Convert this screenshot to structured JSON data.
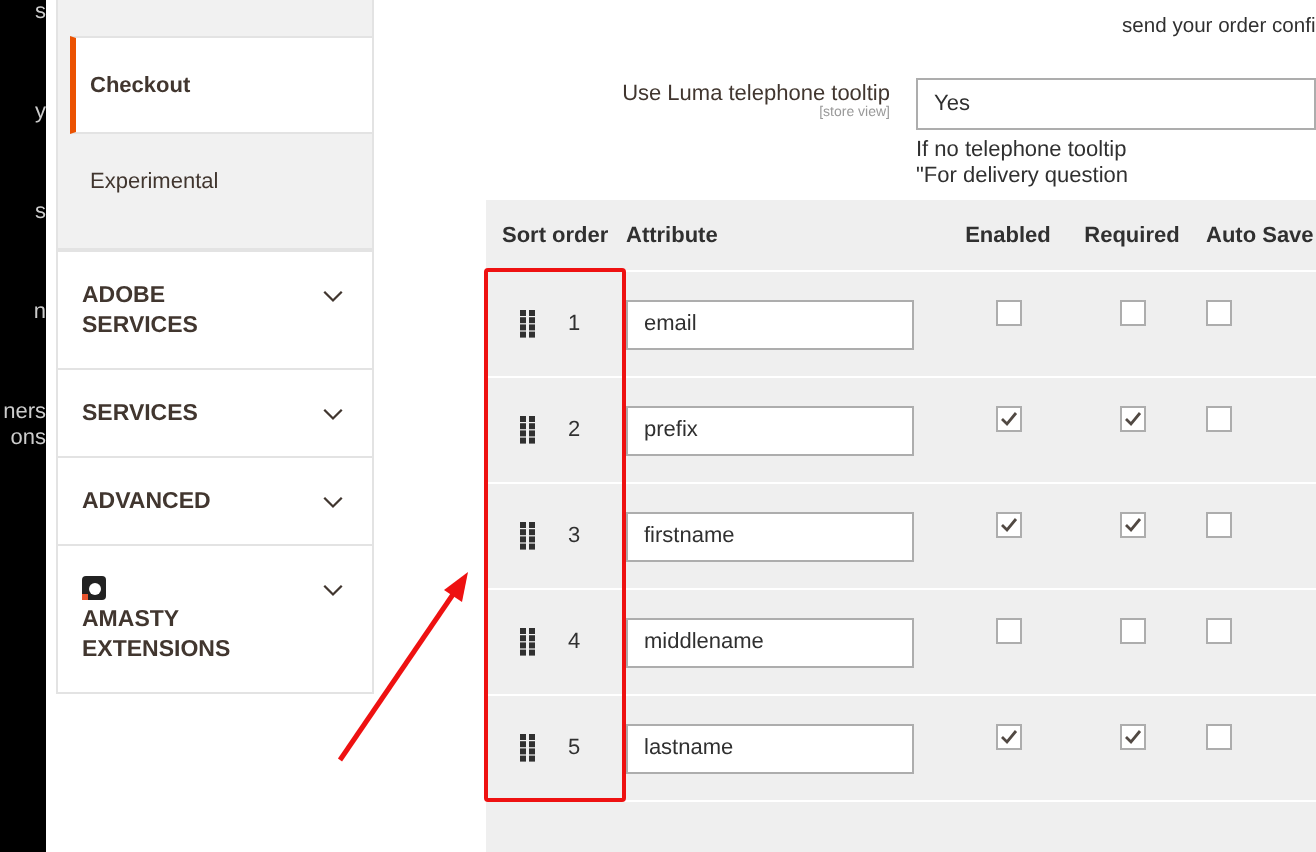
{
  "admin_nav": [
    {
      "lines": [
        "s"
      ]
    },
    {
      "lines": [
        "y"
      ]
    },
    {
      "lines": [
        "s"
      ]
    },
    {
      "lines": [
        "n"
      ]
    },
    {
      "lines": [
        "ners",
        "ons"
      ]
    }
  ],
  "sidebar": {
    "sub_items": [
      {
        "label": "Checkout",
        "selected": true
      },
      {
        "label": "Experimental",
        "selected": false
      }
    ],
    "sections": [
      {
        "label": "ADOBE SERVICES",
        "expanded": false,
        "kind": "plain"
      },
      {
        "label": "SERVICES",
        "expanded": false,
        "kind": "plain"
      },
      {
        "label": "ADVANCED",
        "expanded": false,
        "kind": "plain"
      },
      {
        "label": "AMASTY EXTENSIONS",
        "expanded": false,
        "kind": "logo"
      }
    ]
  },
  "email_note": "send your order confi",
  "telephone_tooltip": {
    "label": "Use Luma telephone tooltip",
    "scope": "[store view]",
    "value": "Yes",
    "note_lines": [
      "If no telephone tooltip",
      "\"For delivery question"
    ]
  },
  "table": {
    "columns": [
      "Sort order",
      "Attribute",
      "Enabled",
      "Required",
      "Auto Save"
    ],
    "rows": [
      {
        "sort_order": "1",
        "attribute": "email",
        "enabled": false,
        "required": false,
        "auto_save": false
      },
      {
        "sort_order": "2",
        "attribute": "prefix",
        "enabled": true,
        "required": true,
        "auto_save": false
      },
      {
        "sort_order": "3",
        "attribute": "firstname",
        "enabled": true,
        "required": true,
        "auto_save": false
      },
      {
        "sort_order": "4",
        "attribute": "middlename",
        "enabled": false,
        "required": false,
        "auto_save": false
      },
      {
        "sort_order": "5",
        "attribute": "lastname",
        "enabled": true,
        "required": true,
        "auto_save": false
      }
    ]
  }
}
